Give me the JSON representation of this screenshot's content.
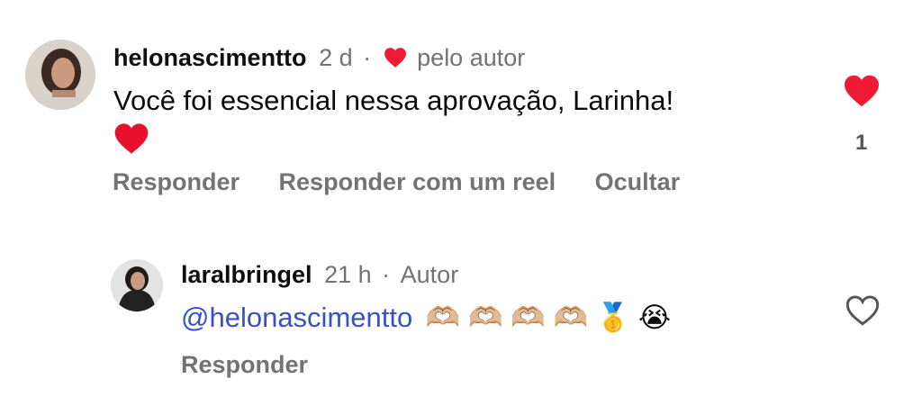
{
  "comment_1": {
    "username": "helonascimentto",
    "time": "2 d",
    "separator": "·",
    "liked_by_author": "pelo autor",
    "text": "Você foi essencial nessa aprovação, Larinha!",
    "like_count": "1",
    "actions": [
      "Responder",
      "Responder com um reel",
      "Ocultar"
    ]
  },
  "comment_2": {
    "username": "laralbringel",
    "time": "21 h",
    "separator": "·",
    "author_badge": "Autor",
    "mention": "@helonascimentto",
    "emoji_text": "🫶🏼 🫶🏼 🫶🏼 🫶🏼 🥇 😭",
    "actions": [
      "Responder"
    ]
  },
  "icons": {
    "heart_filled": "heart-icon",
    "heart_outline": "heart-outline-icon"
  },
  "colors": {
    "heart_red": "#ed1c34",
    "mention_blue": "#3a50c8",
    "muted_gray": "#737373"
  }
}
